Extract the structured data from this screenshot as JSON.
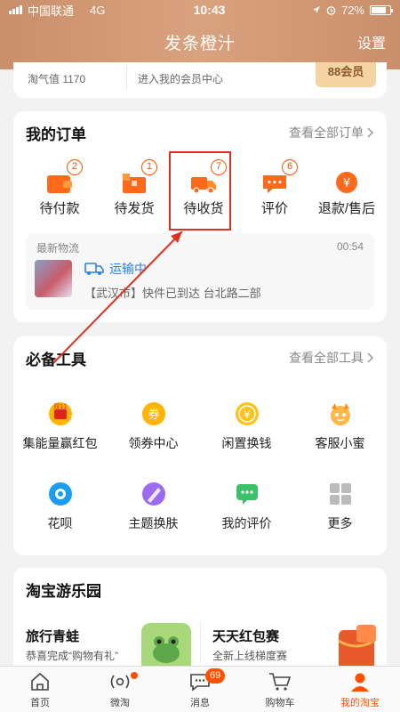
{
  "status_bar": {
    "carrier": "中国联通",
    "network": "4G",
    "time": "10:43",
    "battery": "72%"
  },
  "header": {
    "title": "发条橙汁",
    "settings_label": "设置"
  },
  "member": {
    "taoqi": "淘气值 1170",
    "entry": "进入我的会员中心",
    "badge": "88会员"
  },
  "orders": {
    "title": "我的订单",
    "view_all": "查看全部订单",
    "items": [
      {
        "label": "待付款",
        "count": "2",
        "icon": "wallet-icon"
      },
      {
        "label": "待发货",
        "count": "1",
        "icon": "package-icon"
      },
      {
        "label": "待收货",
        "count": "7",
        "icon": "truck-icon"
      },
      {
        "label": "评价",
        "count": "6",
        "icon": "comment-icon"
      },
      {
        "label": "退款/售后",
        "count": "",
        "icon": "refund-icon"
      }
    ]
  },
  "logistics": {
    "label": "最新物流",
    "time": "00:54",
    "status": "运输中",
    "desc": "【武汉市】快件已到达 台北路二部"
  },
  "tools": {
    "title": "必备工具",
    "view_all": "查看全部工具",
    "items": [
      {
        "label": "集能量赢红包",
        "icon": "double11-icon"
      },
      {
        "label": "领券中心",
        "icon": "coupon-icon"
      },
      {
        "label": "闲置换钱",
        "icon": "yuan-coin-icon"
      },
      {
        "label": "客服小蜜",
        "icon": "assistant-icon"
      },
      {
        "label": "花呗",
        "icon": "huabei-icon"
      },
      {
        "label": "主题换肤",
        "icon": "palette-icon"
      },
      {
        "label": "我的评价",
        "icon": "chat-icon"
      },
      {
        "label": "更多",
        "icon": "grid-icon"
      }
    ]
  },
  "park": {
    "title": "淘宝游乐园",
    "left": {
      "title": "旅行青蛙",
      "subtitle": "恭喜完成“购物有礼”"
    },
    "right": {
      "title": "天天红包赛",
      "subtitle": "全新上线梯度赛"
    }
  },
  "tabbar": {
    "items": [
      {
        "label": "首页",
        "icon": "home-icon"
      },
      {
        "label": "微淘",
        "icon": "weitao-icon"
      },
      {
        "label": "消息",
        "icon": "message-icon",
        "badge": "69"
      },
      {
        "label": "购物车",
        "icon": "cart-icon"
      },
      {
        "label": "我的淘宝",
        "icon": "profile-icon"
      }
    ]
  },
  "colors": {
    "accent": "#ff5000",
    "header": "#d19a74",
    "link_blue": "#2e80e8",
    "annotation_red": "#e03020"
  }
}
